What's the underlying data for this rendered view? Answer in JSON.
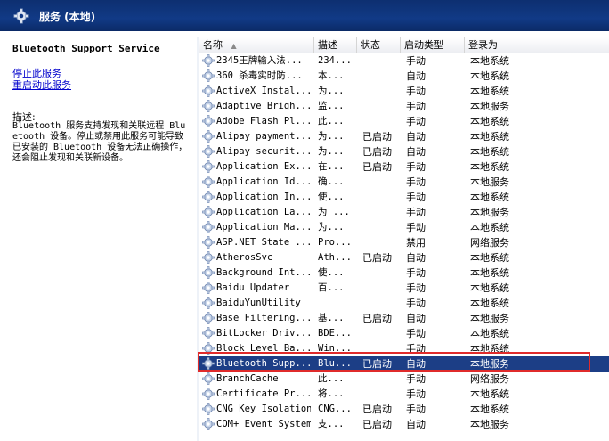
{
  "window": {
    "title": "服务 (本地)"
  },
  "detail": {
    "service_name": "Bluetooth Support Service",
    "stop_link": "停止此服务",
    "restart_link": "重启动此服务",
    "desc_label": "描述:",
    "description": "Bluetooth 服务支持发现和关联远程 Bluetooth 设备。停止或禁用此服务可能导致已安装的 Bluetooth 设备无法正确操作，还会阻止发现和关联新设备。"
  },
  "table": {
    "columns": {
      "name": "名称",
      "desc": "描述",
      "status": "状态",
      "startup": "启动类型",
      "login": "登录为"
    },
    "rows": [
      {
        "name": "2345王牌输入法...",
        "desc": "234...",
        "status": "",
        "startup": "手动",
        "login": "本地系统"
      },
      {
        "name": "360 杀毒实时防...",
        "desc": "本...",
        "status": "",
        "startup": "自动",
        "login": "本地系统"
      },
      {
        "name": "ActiveX Instal...",
        "desc": "为...",
        "status": "",
        "startup": "手动",
        "login": "本地系统"
      },
      {
        "name": "Adaptive Brigh...",
        "desc": "监...",
        "status": "",
        "startup": "手动",
        "login": "本地服务"
      },
      {
        "name": "Adobe Flash Pl...",
        "desc": "此...",
        "status": "",
        "startup": "手动",
        "login": "本地系统"
      },
      {
        "name": "Alipay payment...",
        "desc": "为...",
        "status": "已启动",
        "startup": "自动",
        "login": "本地系统"
      },
      {
        "name": "Alipay securit...",
        "desc": "为...",
        "status": "已启动",
        "startup": "自动",
        "login": "本地系统"
      },
      {
        "name": "Application Ex...",
        "desc": "在...",
        "status": "已启动",
        "startup": "手动",
        "login": "本地系统"
      },
      {
        "name": "Application Id...",
        "desc": "确...",
        "status": "",
        "startup": "手动",
        "login": "本地服务"
      },
      {
        "name": "Application In...",
        "desc": "使...",
        "status": "",
        "startup": "手动",
        "login": "本地系统"
      },
      {
        "name": "Application La...",
        "desc": "为 ...",
        "status": "",
        "startup": "手动",
        "login": "本地服务"
      },
      {
        "name": "Application Ma...",
        "desc": "为...",
        "status": "",
        "startup": "手动",
        "login": "本地系统"
      },
      {
        "name": "ASP.NET State ...",
        "desc": "Pro...",
        "status": "",
        "startup": "禁用",
        "login": "网络服务"
      },
      {
        "name": "AtherosSvc",
        "desc": "Ath...",
        "status": "已启动",
        "startup": "自动",
        "login": "本地系统"
      },
      {
        "name": "Background Int...",
        "desc": "使...",
        "status": "",
        "startup": "手动",
        "login": "本地系统"
      },
      {
        "name": "Baidu Updater",
        "desc": "百...",
        "status": "",
        "startup": "手动",
        "login": "本地系统"
      },
      {
        "name": "BaiduYunUtility",
        "desc": "",
        "status": "",
        "startup": "手动",
        "login": "本地系统"
      },
      {
        "name": "Base Filtering...",
        "desc": "基...",
        "status": "已启动",
        "startup": "自动",
        "login": "本地服务"
      },
      {
        "name": "BitLocker Driv...",
        "desc": "BDE...",
        "status": "",
        "startup": "手动",
        "login": "本地系统"
      },
      {
        "name": "Block Level Ba...",
        "desc": "Win...",
        "status": "",
        "startup": "手动",
        "login": "本地系统"
      },
      {
        "name": "Bluetooth Supp...",
        "desc": "Blu...",
        "status": "已启动",
        "startup": "自动",
        "login": "本地服务",
        "selected": true
      },
      {
        "name": "BranchCache",
        "desc": "此...",
        "status": "",
        "startup": "手动",
        "login": "网络服务"
      },
      {
        "name": "Certificate Pr...",
        "desc": "将...",
        "status": "",
        "startup": "手动",
        "login": "本地系统"
      },
      {
        "name": "CNG Key Isolation",
        "desc": "CNG...",
        "status": "已启动",
        "startup": "手动",
        "login": "本地系统"
      },
      {
        "name": "COM+ Event System",
        "desc": "支...",
        "status": "已启动",
        "startup": "自动",
        "login": "本地服务"
      }
    ]
  }
}
